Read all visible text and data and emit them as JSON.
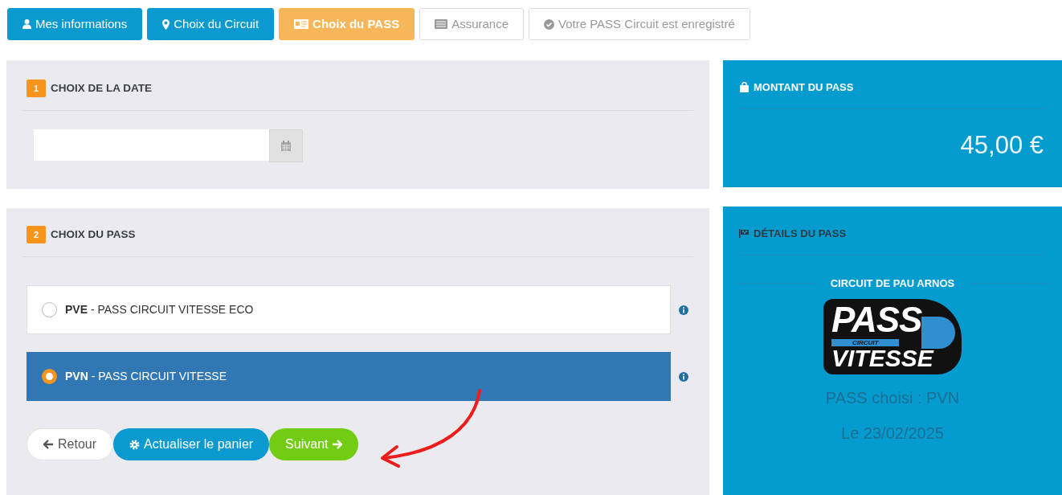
{
  "steps": [
    {
      "label": "Mes informations",
      "kind": "done"
    },
    {
      "label": "Choix du Circuit",
      "kind": "done"
    },
    {
      "label": "Choix du PASS",
      "kind": "current"
    },
    {
      "label": "Assurance",
      "kind": "pending"
    },
    {
      "label": "Votre PASS Circuit est enregistré",
      "kind": "pending"
    }
  ],
  "date_section": {
    "number": "1",
    "title": "CHOIX DE LA DATE"
  },
  "pass_section": {
    "number": "2",
    "title": "CHOIX DU PASS",
    "options": [
      {
        "label": "**PVE** - PASS CIRCUIT VITESSE ECO",
        "selected": false
      },
      {
        "label": "**PVN** - PASS CIRCUIT VITESSE",
        "selected": true
      }
    ],
    "buttons": [
      {
        "label": "Retour",
        "kind": "back"
      },
      {
        "label": "Actualiser le panier",
        "kind": "refresh"
      },
      {
        "label": "Suivant",
        "kind": "next"
      }
    ]
  },
  "amount_panel": {
    "title": "MONTANT DU PASS",
    "amount": "45,00 €"
  },
  "details_panel": {
    "title": "DÉTAILS DU PASS",
    "circuit": "CIRCUIT DE PAU ARNOS",
    "logo": {
      "line_1": "PASS",
      "line_2": "CIRCUIT",
      "line_3": "VITESSE"
    },
    "chosen": "PASS choisi : PVN",
    "date": "Le 23/02/2025"
  }
}
